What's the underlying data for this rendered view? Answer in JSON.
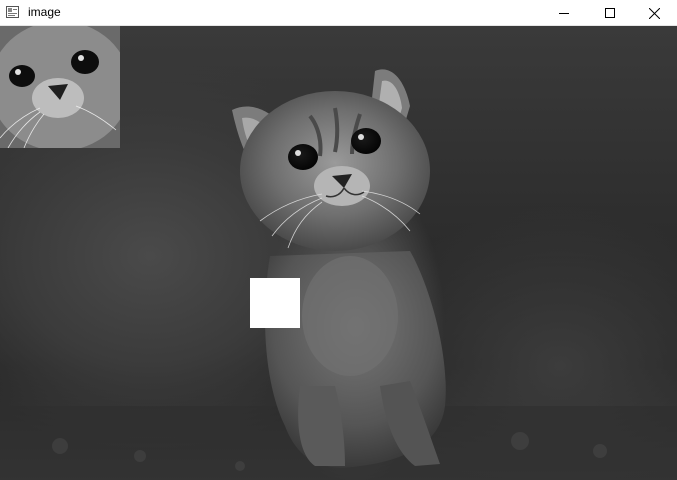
{
  "window": {
    "title": "image",
    "icons": {
      "app": "app-window-icon",
      "minimize": "minimize-icon",
      "maximize": "maximize-icon",
      "close": "close-icon"
    }
  },
  "content": {
    "image_subject": "grayscale-kitten-photo",
    "overlay_square_color": "#ffffff"
  }
}
